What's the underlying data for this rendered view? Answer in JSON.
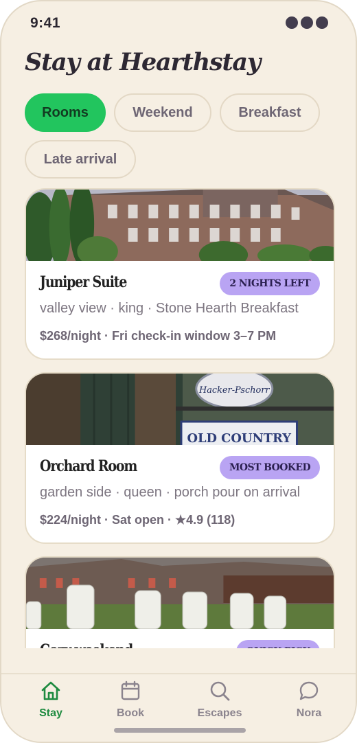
{
  "status_bar": {
    "time": "9:41"
  },
  "header": {
    "title": "Stay at Hearthstay"
  },
  "filters": {
    "chips": [
      {
        "label": "Rooms",
        "active": true
      },
      {
        "label": "Weekend",
        "active": false
      },
      {
        "label": "Breakfast",
        "active": false
      },
      {
        "label": "Late arrival",
        "active": false
      }
    ]
  },
  "rooms": [
    {
      "title": "Juniper Suite",
      "badge": "2 NIGHTS LEFT",
      "description": "valley view · king · Stone Hearth Breakfast",
      "meta": "$268/night · Fri check-in window 3–7 PM",
      "photo": "inn-exterior-photo"
    },
    {
      "title": "Orchard Room",
      "badge": "MOST BOOKED",
      "description": "garden side · queen · porch pour on arrival",
      "meta": "$224/night · Sat open · ★4.9 (118)",
      "photo": "pub-signs-photo"
    },
    {
      "title": "Cozy weekend",
      "badge": "QUICK PICK",
      "description": "",
      "meta": "",
      "photo": "lawn-chairs-photo"
    }
  ],
  "tabbar": {
    "tabs": [
      {
        "label": "Stay",
        "icon": "home-icon",
        "active": true
      },
      {
        "label": "Book",
        "icon": "calendar-icon",
        "active": false
      },
      {
        "label": "Escapes",
        "icon": "search-icon",
        "active": false
      },
      {
        "label": "Nora",
        "icon": "chat-bubble-icon",
        "active": false
      }
    ]
  },
  "colors": {
    "background": "#f6efe3",
    "accent": "#22c55e",
    "badge": "#b9a4f3",
    "active_tab": "#1d8a3f"
  }
}
